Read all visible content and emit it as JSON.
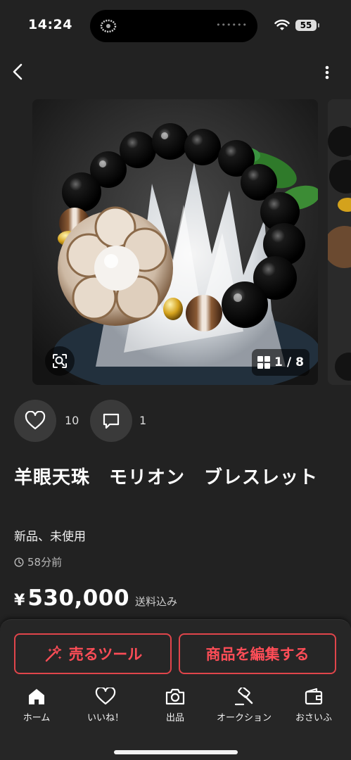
{
  "status_bar": {
    "time": "14:24",
    "island_indicator": "••••••",
    "battery": "55"
  },
  "carousel": {
    "current": "1",
    "total": "8",
    "page_separator": "/"
  },
  "actions": {
    "like_count": "10",
    "comment_count": "1"
  },
  "product": {
    "title": "羊眼天珠　モリオン　ブレスレット",
    "condition": "新品、未使用",
    "posted_ago": "58分前",
    "currency_symbol": "¥",
    "price": "530,000",
    "shipping": "送料込み"
  },
  "buttons": {
    "sell_tool": "売るツール",
    "edit_item": "商品を編集する"
  },
  "tabbar": {
    "items": [
      {
        "label": "ホーム",
        "icon": "home-icon"
      },
      {
        "label": "いいね！",
        "icon": "heart-icon"
      },
      {
        "label": "出品",
        "icon": "camera-icon"
      },
      {
        "label": "オークション",
        "icon": "gavel-icon"
      },
      {
        "label": "おさいふ",
        "icon": "wallet-icon"
      }
    ]
  },
  "colors": {
    "background": "#222222",
    "accent": "#ff4d57",
    "sheet": "#262626"
  }
}
